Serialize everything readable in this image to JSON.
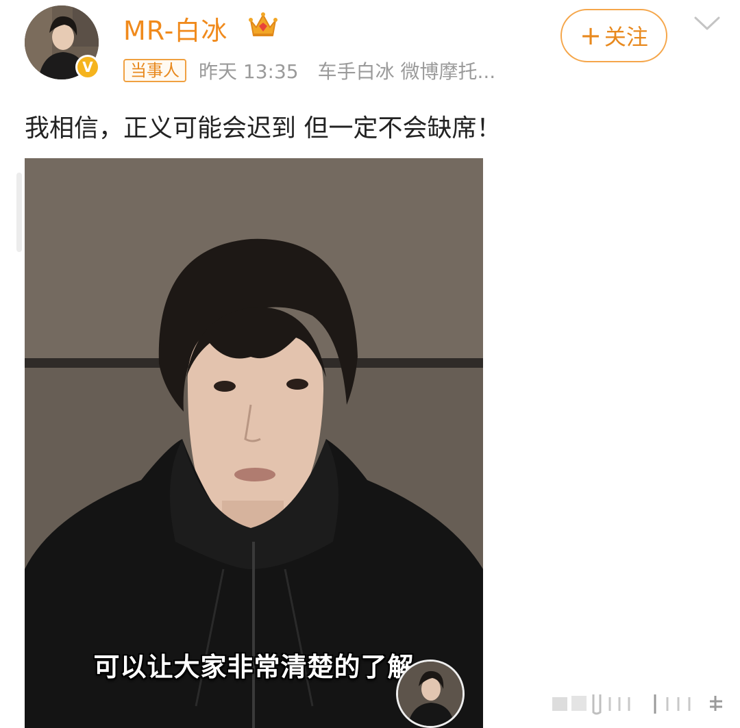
{
  "post": {
    "author": {
      "name": "MR-白冰",
      "avatar_icon": "user-avatar",
      "verified_icon": "verified-v-icon",
      "verified_glyph": "V",
      "crown_icon": "crown-icon"
    },
    "badge": "当事人",
    "timestamp": "昨天 13:35",
    "source": "车手白冰 微博摩托...",
    "follow_button": {
      "plus": "+",
      "label": "关注"
    },
    "more_icon": "chevron-down-icon",
    "text": "我相信，正义可能会迟到 但一定不会缺席！",
    "video": {
      "subtitle": "可以让大家非常清楚的了解",
      "pip_icon": "author-pip-avatar"
    }
  },
  "colors": {
    "accent": "#f08a1c",
    "follow_border": "#f5a64a",
    "meta_gray": "#9a9a9a",
    "verified": "#f5b41e"
  }
}
